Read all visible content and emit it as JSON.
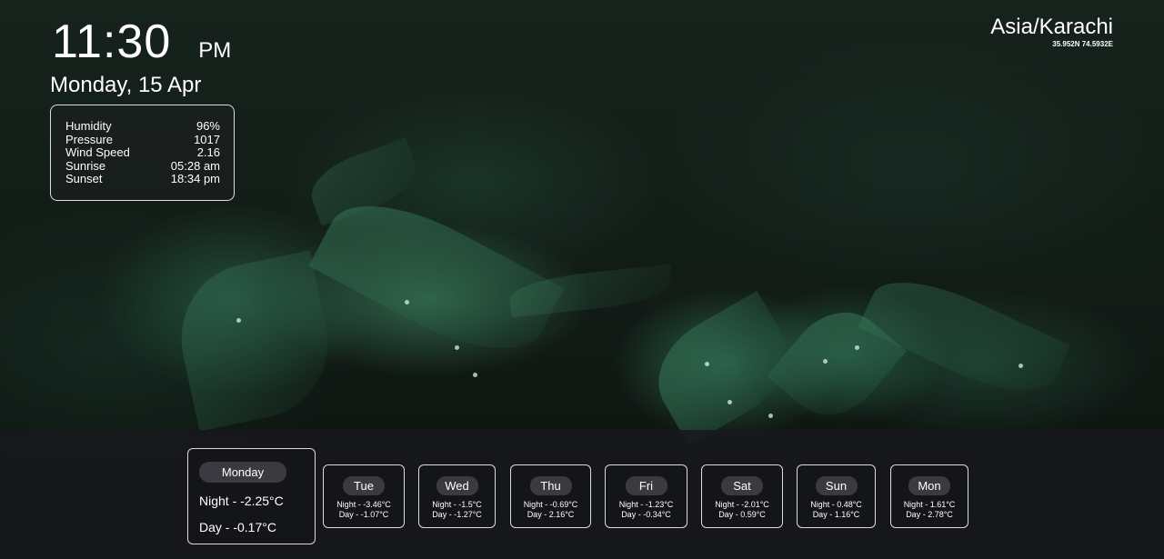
{
  "clock": {
    "time": "11:30",
    "period": "PM",
    "date": "Monday, 15 Apr"
  },
  "timezone": {
    "name": "Asia/Karachi",
    "coords": "35.952N 74.5932E"
  },
  "details": [
    {
      "label": "Humidity",
      "value": "96%"
    },
    {
      "label": "Pressure",
      "value": "1017"
    },
    {
      "label": "Wind Speed",
      "value": "2.16"
    },
    {
      "label": "Sunrise",
      "value": "05:28 am"
    },
    {
      "label": "Sunset",
      "value": "18:34 pm"
    }
  ],
  "today": {
    "day": "Monday",
    "night": "Night - -2.25°C",
    "daytime": "Day - -0.17°C"
  },
  "forecast": [
    {
      "day": "Tue",
      "night": "Night - -3.46°C",
      "daytime": "Day - -1.07°C"
    },
    {
      "day": "Wed",
      "night": "Night - -1.5°C",
      "daytime": "Day - -1.27°C"
    },
    {
      "day": "Thu",
      "night": "Night - -0.69°C",
      "daytime": "Day - 2.16°C"
    },
    {
      "day": "Fri",
      "night": "Night - -1.23°C",
      "daytime": "Day - -0.34°C"
    },
    {
      "day": "Sat",
      "night": "Night - -2.01°C",
      "daytime": "Day - 0.59°C"
    },
    {
      "day": "Sun",
      "night": "Night - 0.48°C",
      "daytime": "Day - 1.16°C"
    },
    {
      "day": "Mon",
      "night": "Night - 1.61°C",
      "daytime": "Day - 2.78°C"
    }
  ]
}
